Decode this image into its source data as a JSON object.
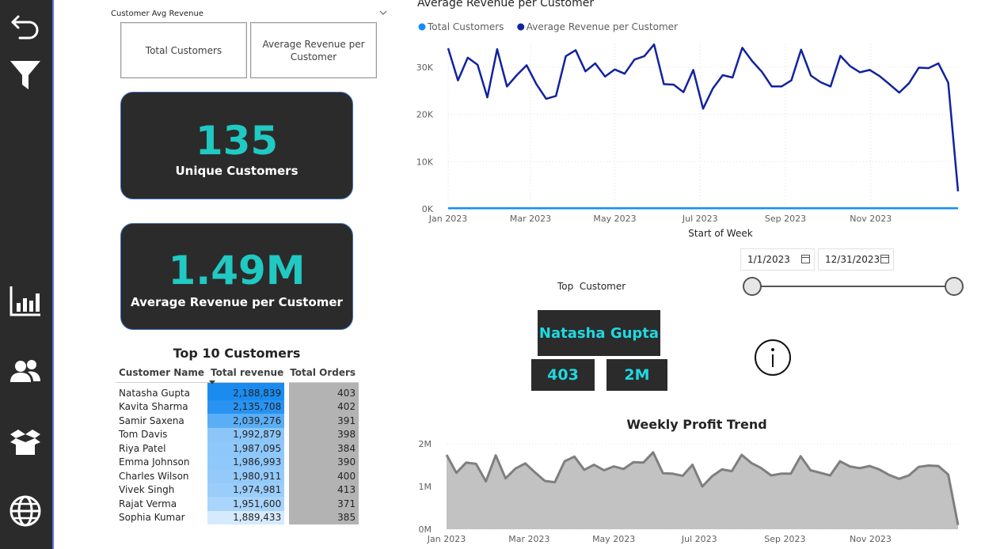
{
  "nav": [
    {
      "name": "back-icon"
    },
    {
      "name": "filter-icon"
    },
    {
      "name": "bar-chart-icon"
    },
    {
      "name": "users-icon"
    },
    {
      "name": "box-icon"
    },
    {
      "name": "globe-icon"
    }
  ],
  "slicer": {
    "title": "Customer Avg Revenue",
    "options": [
      "Total Customers",
      "Average Revenue per Customer"
    ]
  },
  "kpi": {
    "unique_customers_value": "135",
    "unique_customers_label": "Unique Customers",
    "avg_revenue_value": "1.49M",
    "avg_revenue_label": "Average Revenue per Customer"
  },
  "top10": {
    "title": "Top 10 Customers",
    "columns": [
      "Customer Name",
      "Total revenue",
      "Total Orders"
    ],
    "rows": [
      {
        "name": "Natasha Gupta",
        "revenue": "2,188,839",
        "orders": "403"
      },
      {
        "name": "Kavita Sharma",
        "revenue": "2,135,708",
        "orders": "402"
      },
      {
        "name": "Samir Saxena",
        "revenue": "2,039,276",
        "orders": "391"
      },
      {
        "name": "Tom Davis",
        "revenue": "1,992,879",
        "orders": "398"
      },
      {
        "name": "Riya Patel",
        "revenue": "1,987,095",
        "orders": "384"
      },
      {
        "name": "Emma Johnson",
        "revenue": "1,986,993",
        "orders": "390"
      },
      {
        "name": "Charles Wilson",
        "revenue": "1,980,911",
        "orders": "400"
      },
      {
        "name": "Vivek Singh",
        "revenue": "1,974,981",
        "orders": "413"
      },
      {
        "name": "Rajat Verma",
        "revenue": "1,951,600",
        "orders": "371"
      },
      {
        "name": "Sophia Kumar",
        "revenue": "1,889,433",
        "orders": "385"
      }
    ],
    "revenue_colors": [
      "#1a8cf0",
      "#2893f2",
      "#5aaef6",
      "#8cc6f9",
      "#8ec7fa",
      "#8fc8fa",
      "#94cafa",
      "#9acdfa",
      "#a9d4fb",
      "#d6eafd"
    ],
    "orders_color": "#b3b3b3"
  },
  "date_range": {
    "start": "1/1/2023",
    "end": "12/31/2023"
  },
  "top_customer": {
    "label": "Top  Customer",
    "name": "Natasha Gupta",
    "orders": "403",
    "revenue": "2M"
  },
  "info_icon": "info-icon",
  "chart_data": [
    {
      "type": "line",
      "title": "Average Revenue per Customer",
      "xlabel": "Start of Week",
      "ylabel": "",
      "legend": "top-left",
      "grid": true,
      "ylim": [
        0,
        35000
      ],
      "yticks": [
        "0K",
        "10K",
        "20K",
        "30K"
      ],
      "xticks": [
        "Jan 2023",
        "Mar 2023",
        "May 2023",
        "Jul 2023",
        "Sep 2023",
        "Nov 2023"
      ],
      "series": [
        {
          "name": "Total Customers",
          "color": "#118dff",
          "values": [
            135,
            135,
            135,
            135,
            135,
            135,
            135,
            135,
            135,
            135,
            135,
            135,
            135,
            135,
            135,
            135,
            135,
            135,
            135,
            135,
            135,
            135,
            135,
            135,
            135,
            135,
            135,
            135,
            135,
            135,
            135,
            135,
            135,
            135,
            135,
            135,
            135,
            135,
            135,
            135,
            135,
            135,
            135,
            135,
            135,
            135,
            135,
            135,
            135,
            135,
            135,
            135,
            135
          ]
        },
        {
          "name": "Average Revenue per Customer",
          "color": "#12239e",
          "values": [
            34000,
            27200,
            32000,
            30500,
            23600,
            33800,
            25900,
            28300,
            30400,
            26400,
            23300,
            23900,
            32300,
            33600,
            29100,
            30800,
            28000,
            29500,
            28600,
            31600,
            32300,
            34800,
            26400,
            26300,
            24700,
            29400,
            21200,
            25500,
            28300,
            27800,
            34100,
            31300,
            29000,
            25900,
            25900,
            27200,
            33700,
            28200,
            26800,
            25900,
            32400,
            30200,
            28900,
            29400,
            28100,
            26400,
            24600,
            26600,
            29900,
            29800,
            30800,
            26700,
            3700
          ]
        }
      ]
    },
    {
      "type": "area",
      "title": "Weekly Profit Trend",
      "xlabel": "",
      "ylabel": "",
      "grid": true,
      "ylim": [
        0,
        2000000
      ],
      "yticks": [
        "0M",
        "1M",
        "2M"
      ],
      "xticks": [
        "Jan 2023",
        "Mar 2023",
        "May 2023",
        "Jul 2023",
        "Sep 2023",
        "Nov 2023"
      ],
      "series": [
        {
          "name": "",
          "color": "#7f7f7f",
          "values": [
            1740000,
            1320000,
            1560000,
            1530000,
            1120000,
            1730000,
            1190000,
            1420000,
            1540000,
            1330000,
            1130000,
            1100000,
            1590000,
            1700000,
            1390000,
            1510000,
            1380000,
            1470000,
            1410000,
            1570000,
            1560000,
            1800000,
            1310000,
            1300000,
            1250000,
            1510000,
            1000000,
            1240000,
            1400000,
            1360000,
            1740000,
            1550000,
            1430000,
            1260000,
            1300000,
            1300000,
            1710000,
            1380000,
            1320000,
            1260000,
            1590000,
            1470000,
            1430000,
            1480000,
            1400000,
            1270000,
            1180000,
            1260000,
            1460000,
            1490000,
            1480000,
            1280000,
            100000
          ]
        }
      ]
    }
  ]
}
